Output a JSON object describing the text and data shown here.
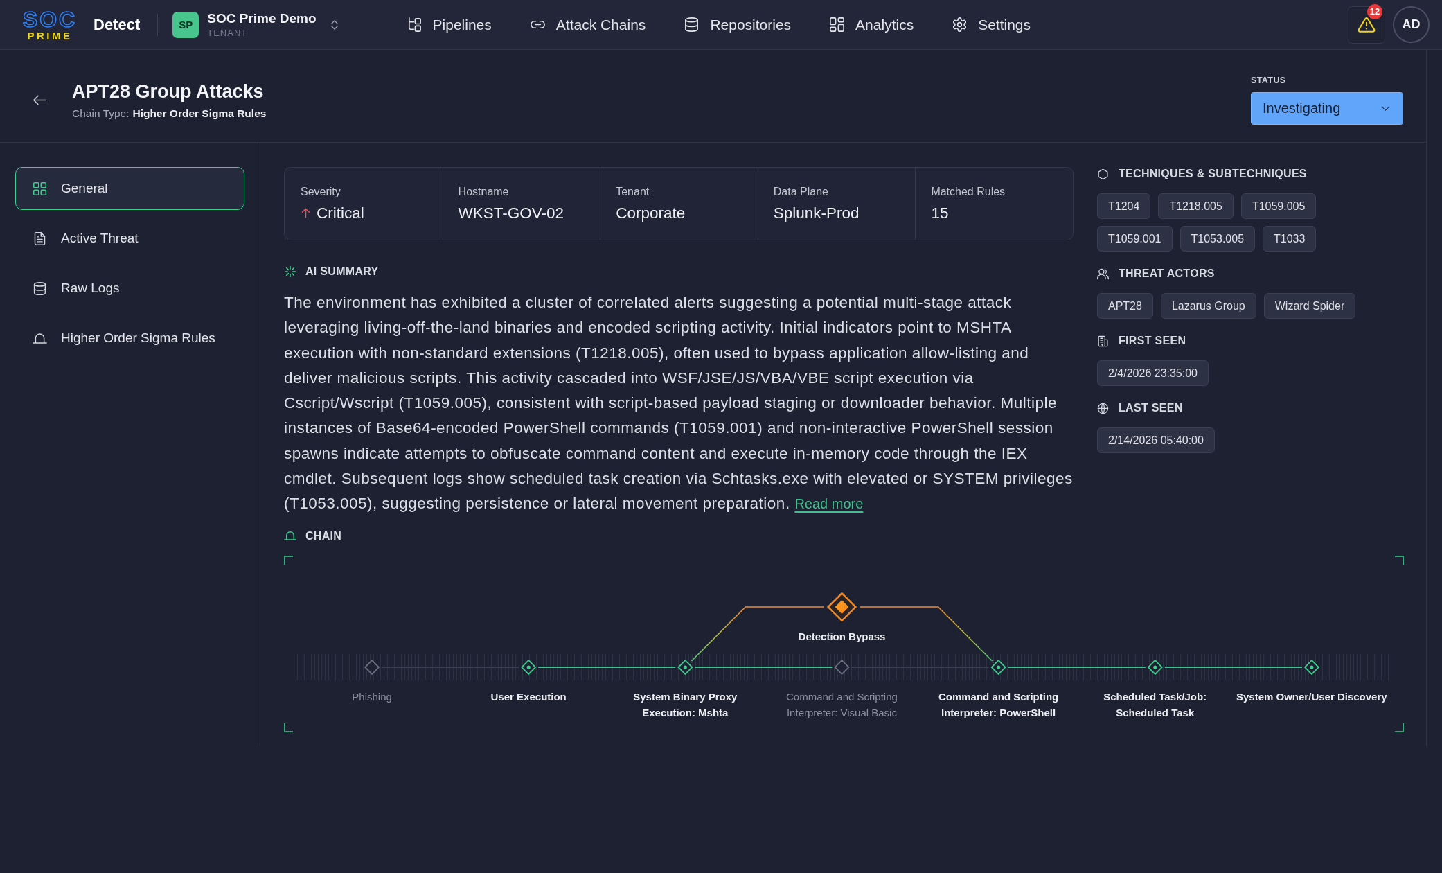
{
  "topbar": {
    "logo": {
      "top": "SOC",
      "bottom": "PRIME"
    },
    "product": "Detect",
    "tenant": {
      "initials": "SP",
      "name": "SOC Prime Demo",
      "caption": "TENANT"
    },
    "nav": [
      "Pipelines",
      "Attack Chains",
      "Repositories",
      "Analytics",
      "Settings"
    ],
    "alerts": {
      "count": "12"
    },
    "user": {
      "initials": "AD"
    }
  },
  "header": {
    "title": "APT28 Group Attacks",
    "chain_type_label": "Chain Type:",
    "chain_type": "Higher Order Sigma Rules",
    "status": {
      "label": "STATUS",
      "value": "Investigating"
    }
  },
  "sidebar": {
    "items": [
      {
        "label": "General",
        "selected": true
      },
      {
        "label": "Active Threat",
        "selected": false
      },
      {
        "label": "Raw Logs",
        "selected": false
      },
      {
        "label": "Higher Order Sigma Rules",
        "selected": false
      }
    ]
  },
  "summary_cards": [
    {
      "label": "Severity",
      "value": "Critical",
      "escalated": true
    },
    {
      "label": "Hostname",
      "value": "WKST-GOV-02",
      "escalated": false
    },
    {
      "label": "Tenant",
      "value": "Corporate",
      "escalated": false
    },
    {
      "label": "Data Plane",
      "value": "Splunk-Prod",
      "escalated": false
    },
    {
      "label": "Matched Rules",
      "value": "15",
      "escalated": false
    }
  ],
  "ai_summary": {
    "title": "AI SUMMARY",
    "text": "The environment has exhibited a cluster of correlated alerts suggesting a potential multi-stage attack leveraging living-off-the-land binaries and encoded scripting activity. Initial indicators point to MSHTA execution with non-standard extensions (T1218.005), often used to bypass application allow-listing and deliver malicious scripts. This activity cascaded into WSF/JSE/JS/VBA/VBE script execution via Cscript/Wscript (T1059.005), consistent with script-based payload staging or downloader behavior. Multiple instances of Base64-encoded PowerShell commands (T1059.001) and non-interactive PowerShell session spawns indicate attempts to obfuscate command content and execute in-memory code through the IEX cmdlet. Subsequent logs show scheduled task creation via Schtasks.exe with elevated or SYSTEM privileges (T1053.005), suggesting persistence or lateral movement preparation.",
    "link": "Read more"
  },
  "chain": {
    "title": "CHAIN",
    "steps": [
      {
        "label": "Phishing",
        "active": false
      },
      {
        "label": "User Execution",
        "active": true
      },
      {
        "label": "System Binary Proxy Execution: Mshta",
        "active": true
      },
      {
        "label": "Command and Scripting Interpreter: Visual Basic",
        "active": false,
        "bypass": {
          "label": "Detection Bypass"
        }
      },
      {
        "label": "Command and Scripting Interpreter: PowerShell",
        "active": true
      },
      {
        "label": "Scheduled Task/Job: Scheduled Task",
        "active": true
      },
      {
        "label": "System Owner/User Discovery",
        "active": true
      }
    ]
  },
  "details": {
    "sections": [
      {
        "kind": "tags",
        "title": "TECHNIQUES & SUBTECHNIQUES",
        "tags": [
          "T1204",
          "T1218.005",
          "T1059.005",
          "T1059.001",
          "T1053.005",
          "T1033"
        ]
      },
      {
        "kind": "tags",
        "title": "THREAT ACTORS",
        "tags": [
          "APT28",
          "Lazarus Group",
          "Wizard Spider"
        ]
      },
      {
        "kind": "date",
        "title": "FIRST SEEN",
        "value": "2/4/2026 23:35:00"
      },
      {
        "kind": "date",
        "title": "LAST SEEN",
        "value": "2/14/2026 05:40:00"
      }
    ]
  }
}
